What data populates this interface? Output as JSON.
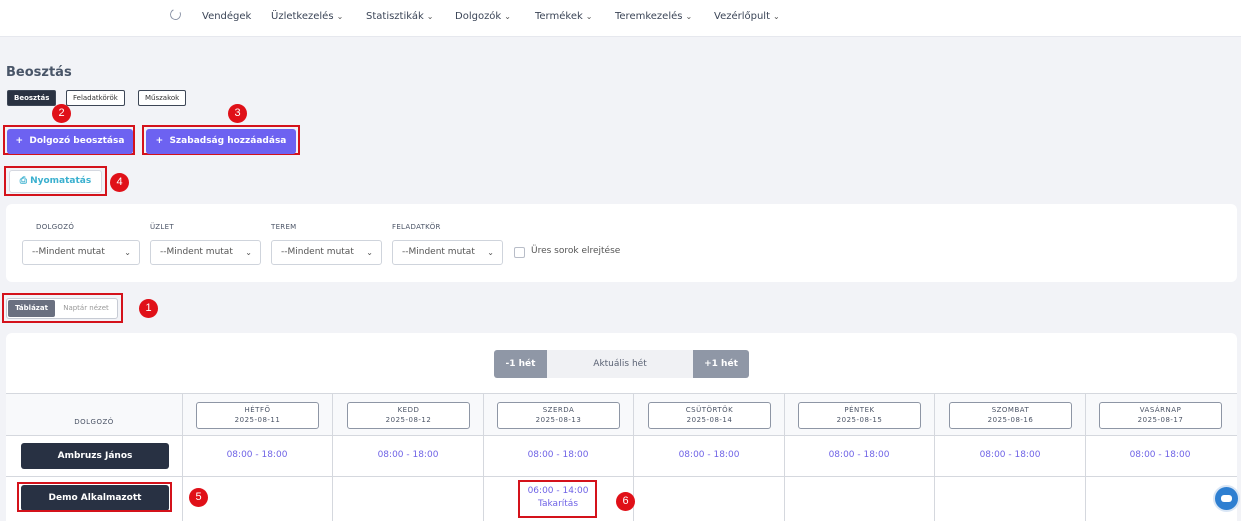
{
  "nav": {
    "items": [
      {
        "label": "Vendégek",
        "dropdown": false
      },
      {
        "label": "Üzletkezelés",
        "dropdown": true
      },
      {
        "label": "Statisztikák",
        "dropdown": true
      },
      {
        "label": "Dolgozók",
        "dropdown": true
      },
      {
        "label": "Termékek",
        "dropdown": true
      },
      {
        "label": "Teremkezelés",
        "dropdown": true
      },
      {
        "label": "Vezérlőpult",
        "dropdown": true
      }
    ],
    "chevron": "⌄"
  },
  "page_title": "Beosztás",
  "tabs": [
    "Beosztás",
    "Feladatkörök",
    "Műszakok"
  ],
  "actions": {
    "add_assignment": "Dolgozó beosztása",
    "add_leave": "Szabadság hozzáadása",
    "print": "Nyomatatás",
    "plus": "+"
  },
  "markers": [
    "1",
    "2",
    "3",
    "4",
    "5",
    "6"
  ],
  "filters": {
    "employee_label": "DOLGOZÓ",
    "shop_label": "ÜZLET",
    "room_label": "TEREM",
    "role_label": "FELADATKÖR",
    "select_value": "--Mindent mutat",
    "hide_empty_label": "Üres sorok elrejtése"
  },
  "view_toggle": {
    "table": "Táblázat",
    "calendar": "Naptár nézet"
  },
  "week_nav": {
    "prev": "-1 hét",
    "current": "Aktuális hét",
    "next": "+1 hét"
  },
  "schedule": {
    "employee_header": "DOLGOZÓ",
    "days": [
      {
        "name": "HÉTFŐ",
        "date": "2025-08-11"
      },
      {
        "name": "KEDD",
        "date": "2025-08-12"
      },
      {
        "name": "SZERDA",
        "date": "2025-08-13"
      },
      {
        "name": "CSÜTÖRTÖK",
        "date": "2025-08-14"
      },
      {
        "name": "PÉNTEK",
        "date": "2025-08-15"
      },
      {
        "name": "SZOMBAT",
        "date": "2025-08-16"
      },
      {
        "name": "VASÁRNAP",
        "date": "2025-08-17"
      }
    ],
    "rows": [
      {
        "employee": "Ambruzs János",
        "shifts": [
          "08:00 - 18:00",
          "08:00 - 18:00",
          "08:00 - 18:00",
          "08:00 - 18:00",
          "08:00 - 18:00",
          "08:00 - 18:00",
          "08:00 - 18:00"
        ]
      },
      {
        "employee": "Demo Alkalmazott",
        "wednesday_shift": "06:00 - 14:00",
        "wednesday_role": "Takarítás"
      }
    ]
  },
  "colors": {
    "accent": "#6d62f1",
    "highlight": "#d4121b",
    "dark": "#283143",
    "link": "#3ab0cf"
  }
}
